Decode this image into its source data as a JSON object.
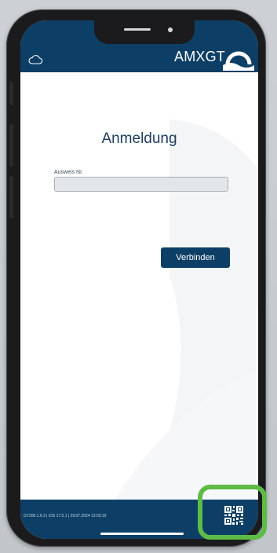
{
  "header": {
    "brand": "AMXGT",
    "cloud_icon": "cloud-icon",
    "logo_icon": "amxgt-logo-icon"
  },
  "login": {
    "title": "Anmeldung",
    "field_label": "Ausweis Nr.",
    "field_value": "",
    "field_placeholder": "",
    "connect_label": "Verbinden"
  },
  "footer": {
    "version_text": "GT200.1.6.3 | iOS 17.5.1 | 29.07.2024 13:03:19",
    "qr_icon": "qr-code-icon"
  },
  "colors": {
    "brand_navy": "#0d3f66",
    "highlight_green": "#5dbb46",
    "input_bg": "#e3e6e8"
  }
}
